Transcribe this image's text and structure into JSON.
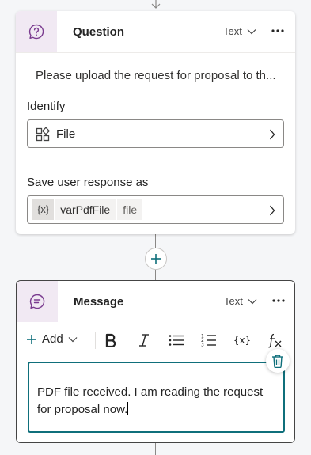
{
  "question_node": {
    "title": "Question",
    "type_label": "Text",
    "prompt": "Please upload the request for proposal to th...",
    "identify_label": "Identify",
    "identify_value": "File",
    "save_label": "Save user response as",
    "variable": {
      "badge": "{x}",
      "name": "varPdfFile",
      "type": "file"
    }
  },
  "message_node": {
    "title": "Message",
    "type_label": "Text",
    "toolbar": {
      "add_label": "Add"
    },
    "message_text": "PDF file received. I am reading the request for proposal now."
  },
  "colors": {
    "accent": "#0f6f7b",
    "icon_bg": "#f1e9f3",
    "icon_stroke": "#7a3b8f"
  }
}
